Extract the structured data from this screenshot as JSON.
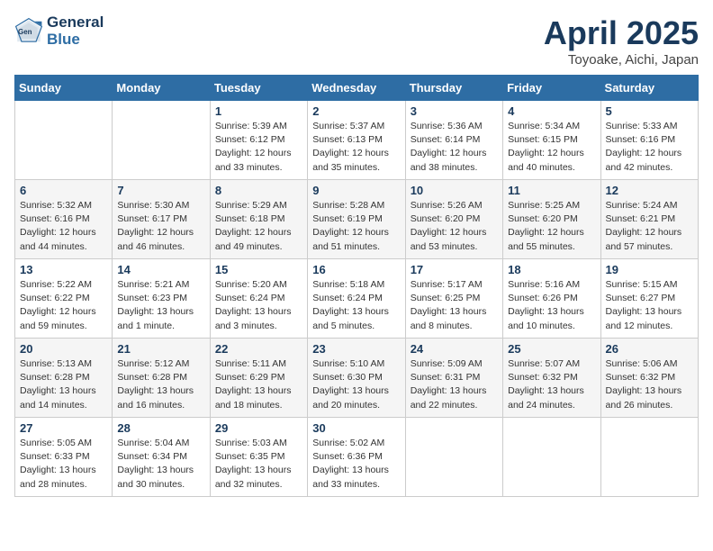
{
  "header": {
    "logo_line1": "General",
    "logo_line2": "Blue",
    "title": "April 2025",
    "subtitle": "Toyoake, Aichi, Japan"
  },
  "weekdays": [
    "Sunday",
    "Monday",
    "Tuesday",
    "Wednesday",
    "Thursday",
    "Friday",
    "Saturday"
  ],
  "weeks": [
    [
      {
        "day": "",
        "info": ""
      },
      {
        "day": "",
        "info": ""
      },
      {
        "day": "1",
        "info": "Sunrise: 5:39 AM\nSunset: 6:12 PM\nDaylight: 12 hours\nand 33 minutes."
      },
      {
        "day": "2",
        "info": "Sunrise: 5:37 AM\nSunset: 6:13 PM\nDaylight: 12 hours\nand 35 minutes."
      },
      {
        "day": "3",
        "info": "Sunrise: 5:36 AM\nSunset: 6:14 PM\nDaylight: 12 hours\nand 38 minutes."
      },
      {
        "day": "4",
        "info": "Sunrise: 5:34 AM\nSunset: 6:15 PM\nDaylight: 12 hours\nand 40 minutes."
      },
      {
        "day": "5",
        "info": "Sunrise: 5:33 AM\nSunset: 6:16 PM\nDaylight: 12 hours\nand 42 minutes."
      }
    ],
    [
      {
        "day": "6",
        "info": "Sunrise: 5:32 AM\nSunset: 6:16 PM\nDaylight: 12 hours\nand 44 minutes."
      },
      {
        "day": "7",
        "info": "Sunrise: 5:30 AM\nSunset: 6:17 PM\nDaylight: 12 hours\nand 46 minutes."
      },
      {
        "day": "8",
        "info": "Sunrise: 5:29 AM\nSunset: 6:18 PM\nDaylight: 12 hours\nand 49 minutes."
      },
      {
        "day": "9",
        "info": "Sunrise: 5:28 AM\nSunset: 6:19 PM\nDaylight: 12 hours\nand 51 minutes."
      },
      {
        "day": "10",
        "info": "Sunrise: 5:26 AM\nSunset: 6:20 PM\nDaylight: 12 hours\nand 53 minutes."
      },
      {
        "day": "11",
        "info": "Sunrise: 5:25 AM\nSunset: 6:20 PM\nDaylight: 12 hours\nand 55 minutes."
      },
      {
        "day": "12",
        "info": "Sunrise: 5:24 AM\nSunset: 6:21 PM\nDaylight: 12 hours\nand 57 minutes."
      }
    ],
    [
      {
        "day": "13",
        "info": "Sunrise: 5:22 AM\nSunset: 6:22 PM\nDaylight: 12 hours\nand 59 minutes."
      },
      {
        "day": "14",
        "info": "Sunrise: 5:21 AM\nSunset: 6:23 PM\nDaylight: 13 hours\nand 1 minute."
      },
      {
        "day": "15",
        "info": "Sunrise: 5:20 AM\nSunset: 6:24 PM\nDaylight: 13 hours\nand 3 minutes."
      },
      {
        "day": "16",
        "info": "Sunrise: 5:18 AM\nSunset: 6:24 PM\nDaylight: 13 hours\nand 5 minutes."
      },
      {
        "day": "17",
        "info": "Sunrise: 5:17 AM\nSunset: 6:25 PM\nDaylight: 13 hours\nand 8 minutes."
      },
      {
        "day": "18",
        "info": "Sunrise: 5:16 AM\nSunset: 6:26 PM\nDaylight: 13 hours\nand 10 minutes."
      },
      {
        "day": "19",
        "info": "Sunrise: 5:15 AM\nSunset: 6:27 PM\nDaylight: 13 hours\nand 12 minutes."
      }
    ],
    [
      {
        "day": "20",
        "info": "Sunrise: 5:13 AM\nSunset: 6:28 PM\nDaylight: 13 hours\nand 14 minutes."
      },
      {
        "day": "21",
        "info": "Sunrise: 5:12 AM\nSunset: 6:28 PM\nDaylight: 13 hours\nand 16 minutes."
      },
      {
        "day": "22",
        "info": "Sunrise: 5:11 AM\nSunset: 6:29 PM\nDaylight: 13 hours\nand 18 minutes."
      },
      {
        "day": "23",
        "info": "Sunrise: 5:10 AM\nSunset: 6:30 PM\nDaylight: 13 hours\nand 20 minutes."
      },
      {
        "day": "24",
        "info": "Sunrise: 5:09 AM\nSunset: 6:31 PM\nDaylight: 13 hours\nand 22 minutes."
      },
      {
        "day": "25",
        "info": "Sunrise: 5:07 AM\nSunset: 6:32 PM\nDaylight: 13 hours\nand 24 minutes."
      },
      {
        "day": "26",
        "info": "Sunrise: 5:06 AM\nSunset: 6:32 PM\nDaylight: 13 hours\nand 26 minutes."
      }
    ],
    [
      {
        "day": "27",
        "info": "Sunrise: 5:05 AM\nSunset: 6:33 PM\nDaylight: 13 hours\nand 28 minutes."
      },
      {
        "day": "28",
        "info": "Sunrise: 5:04 AM\nSunset: 6:34 PM\nDaylight: 13 hours\nand 30 minutes."
      },
      {
        "day": "29",
        "info": "Sunrise: 5:03 AM\nSunset: 6:35 PM\nDaylight: 13 hours\nand 32 minutes."
      },
      {
        "day": "30",
        "info": "Sunrise: 5:02 AM\nSunset: 6:36 PM\nDaylight: 13 hours\nand 33 minutes."
      },
      {
        "day": "",
        "info": ""
      },
      {
        "day": "",
        "info": ""
      },
      {
        "day": "",
        "info": ""
      }
    ]
  ]
}
